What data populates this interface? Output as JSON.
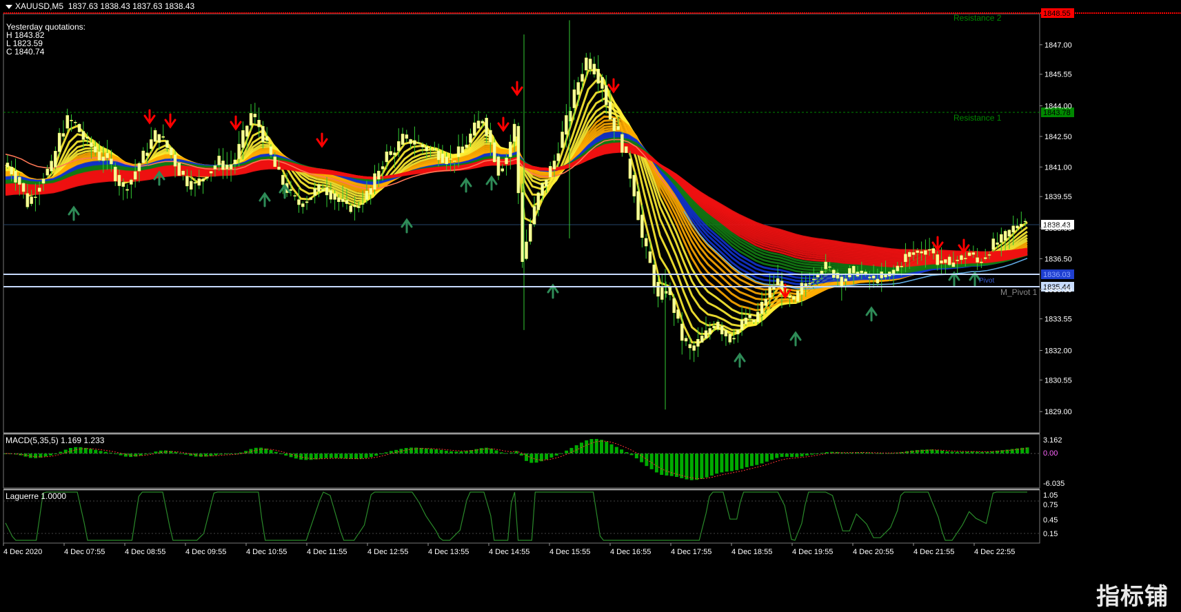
{
  "header": {
    "symbol": "XAUUSD,M5",
    "ohlc": "1837.63 1838.43 1837.63 1838.43"
  },
  "yesterday": {
    "title": "Yesterday quotations:",
    "high": "H 1843.82",
    "low": "L 1823.59",
    "close": "C 1840.74"
  },
  "price_axis": {
    "ticks": [
      "1847.00",
      "1845.55",
      "1844.00",
      "1842.50",
      "1841.00",
      "1839.55",
      "1838.00",
      "1836.50",
      "1835.00",
      "1833.55",
      "1832.00",
      "1830.55",
      "1829.00"
    ],
    "labels": {
      "resistance2": "1848.55",
      "resistance1": "1843.78",
      "current": "1838.43",
      "pivot_mid": "1836.03",
      "pivot": "1835.44"
    }
  },
  "levels": {
    "resistance2_label": "Resistance 2",
    "resistance1_label": "Resistance 1",
    "pivot_label": "M_Pivot 1",
    "pivot_mid_label": "Pivot"
  },
  "macd": {
    "title": "MACD(5,35,5) 1.169 1.233",
    "ticks": [
      "3.162",
      "0.00",
      "-6.035"
    ]
  },
  "laguerre": {
    "title": "Laguerre 1.0000",
    "ticks": [
      "1.05",
      "0.75",
      "0.45",
      "0.15"
    ]
  },
  "time_axis": [
    "4 Dec 2020",
    "4 Dec 07:55",
    "4 Dec 08:55",
    "4 Dec 09:55",
    "4 Dec 10:55",
    "4 Dec 11:55",
    "4 Dec 12:55",
    "4 Dec 13:55",
    "4 Dec 14:55",
    "4 Dec 15:55",
    "4 Dec 16:55",
    "4 Dec 17:55",
    "4 Dec 18:55",
    "4 Dec 19:55",
    "4 Dec 20:55",
    "4 Dec 21:55",
    "4 Dec 22:55"
  ],
  "watermark": "指标铺",
  "colors": {
    "background": "#000000",
    "candle": "#ffff66",
    "candle_body": "#f4ff9a",
    "wick": "#33cc33",
    "resistance": "#ff0000",
    "resistance_text": "#008800",
    "grid_level": "#26466a",
    "pivot_line": "#c8dcff",
    "macd_bar": "#00aa00",
    "macd_signal": "#ff3333",
    "laguerre_line": "#2a8a2a",
    "up_arrow": "#2e8b57",
    "down_arrow": "#ff0000"
  },
  "chart_data": {
    "type": "candlestick",
    "timeframe": "M5",
    "ylim": [
      1828.5,
      1848.55
    ],
    "price_path": [
      1841.2,
      1840.8,
      1840.2,
      1839.2,
      1839.8,
      1840.6,
      1841.0,
      1842.5,
      1843.3,
      1843.1,
      1842.4,
      1842.0,
      1841.5,
      1841.4,
      1840.6,
      1839.9,
      1840.4,
      1841.2,
      1841.9,
      1842.6,
      1842.3,
      1841.6,
      1840.8,
      1840.3,
      1840.1,
      1840.5,
      1840.9,
      1841.3,
      1840.9,
      1841.4,
      1842.5,
      1843.6,
      1843.0,
      1842.0,
      1841.0,
      1840.2,
      1839.6,
      1839.2,
      1839.4,
      1839.8,
      1840.0,
      1839.7,
      1839.3,
      1839.1,
      1839.0,
      1839.4,
      1839.9,
      1840.9,
      1841.6,
      1841.8,
      1842.4,
      1842.3,
      1842.1,
      1841.9,
      1841.8,
      1841.5,
      1841.3,
      1841.7,
      1842.2,
      1842.9,
      1843.4,
      1842.2,
      1840.8,
      1841.5,
      1843.0,
      1836.5,
      1838.2,
      1839.6,
      1840.5,
      1841.3,
      1842.6,
      1843.9,
      1845.2,
      1846.3,
      1845.8,
      1845.0,
      1843.4,
      1842.6,
      1841.4,
      1839.8,
      1837.5,
      1836.2,
      1834.5,
      1835.1,
      1834.0,
      1832.6,
      1832.0,
      1832.4,
      1832.8,
      1833.4,
      1833.0,
      1832.6,
      1833.0,
      1833.6,
      1833.4,
      1834.2,
      1835.0,
      1835.4,
      1834.6,
      1834.4,
      1835.1,
      1835.5,
      1835.9,
      1836.1,
      1835.8,
      1835.4,
      1835.8,
      1835.9,
      1835.6,
      1835.5,
      1835.6,
      1835.7,
      1836.1,
      1836.6,
      1836.8,
      1836.9,
      1837.0,
      1836.4,
      1836.2,
      1836.4,
      1836.5,
      1836.8,
      1836.3,
      1836.7,
      1837.2,
      1837.4,
      1837.8,
      1838.2,
      1838.43
    ]
  }
}
